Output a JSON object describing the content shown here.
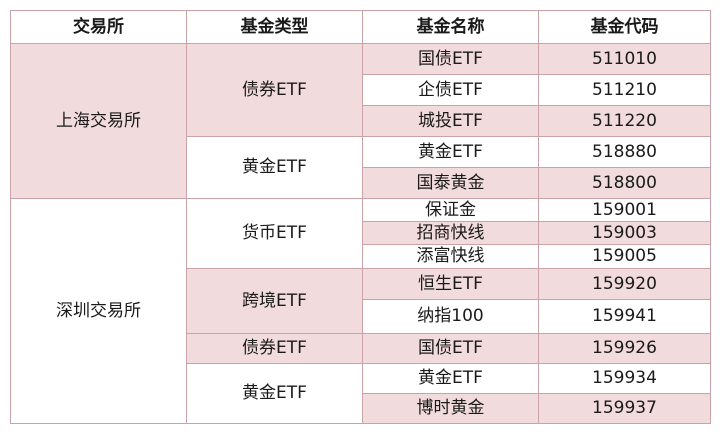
{
  "headers": {
    "exchange": "交易所",
    "fund_type": "基金类型",
    "fund_name": "基金名称",
    "fund_code": "基金代码"
  },
  "exchanges": {
    "shanghai": "上海交易所",
    "shenzhen": "深圳交易所"
  },
  "types": {
    "sh_bond": "债券ETF",
    "sh_gold": "黄金ETF",
    "sz_currency": "货币ETF",
    "sz_cross": "跨境ETF",
    "sz_bond": "债券ETF",
    "sz_gold": "黄金ETF"
  },
  "rows": [
    {
      "name": "国债ETF",
      "code": "511010"
    },
    {
      "name": "企债ETF",
      "code": "511210"
    },
    {
      "name": "城投ETF",
      "code": "511220"
    },
    {
      "name": "黄金ETF",
      "code": "518880"
    },
    {
      "name": "国泰黄金",
      "code": "518800"
    },
    {
      "name": "保证金",
      "code": "159001"
    },
    {
      "name": "招商快线",
      "code": "159003"
    },
    {
      "name": "添富快线",
      "code": "159005"
    },
    {
      "name": "恒生ETF",
      "code": "159920"
    },
    {
      "name": "纳指100",
      "code": "159941"
    },
    {
      "name": "国债ETF",
      "code": "159926"
    },
    {
      "name": "黄金ETF",
      "code": "159934"
    },
    {
      "name": "博时黄金",
      "code": "159937"
    }
  ]
}
